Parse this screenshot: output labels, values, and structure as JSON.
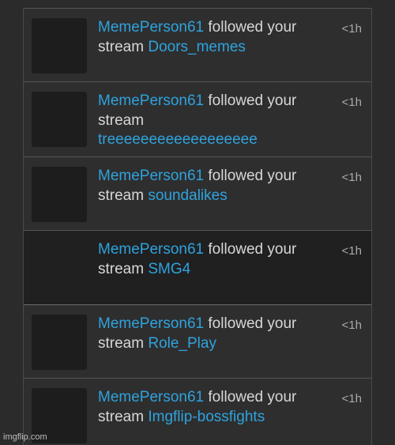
{
  "notifications": [
    {
      "user": "MemePerson61",
      "action_1": "followed your",
      "action_2": "stream",
      "stream": "Doors_memes",
      "time": "<1h"
    },
    {
      "user": "MemePerson61",
      "action_1": "followed your",
      "action_2": "stream",
      "stream": "treeeeeeeeeeeeeeeeee",
      "time": "<1h"
    },
    {
      "user": "MemePerson61",
      "action_1": "followed your",
      "action_2": "stream",
      "stream": "soundalikes",
      "time": "<1h"
    },
    {
      "user": "MemePerson61",
      "action_1": "followed your",
      "action_2": "stream",
      "stream": "SMG4",
      "time": "<1h"
    },
    {
      "user": "MemePerson61",
      "action_1": "followed your",
      "action_2": "stream",
      "stream": "Role_Play",
      "time": "<1h"
    },
    {
      "user": "MemePerson61",
      "action_1": "followed your",
      "action_2": "stream",
      "stream": "Imgflip-bossfights",
      "time": "<1h"
    }
  ],
  "watermark": "imgflip.com",
  "colors": {
    "link": "#2ea3dc",
    "text": "#d7d7d7",
    "background": "#2b2b2c",
    "highlight": "#202021"
  }
}
